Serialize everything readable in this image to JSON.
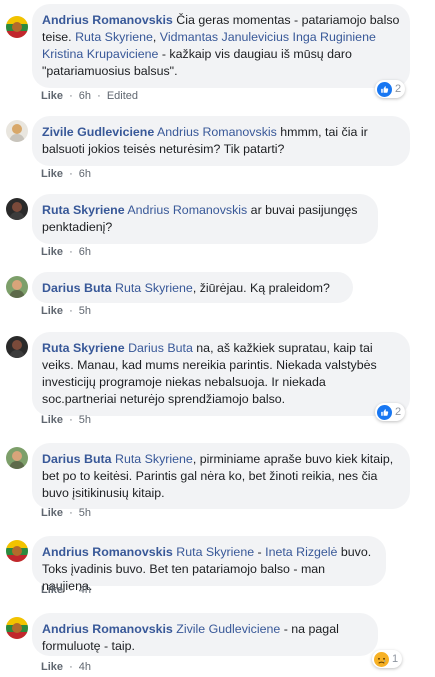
{
  "action_like": "Like",
  "comments": [
    {
      "author": "Andrius Romanovskis",
      "parts": [
        {
          "t": "Čia geras momentas - patariamojo balso teise. "
        },
        {
          "m": "Ruta Skyriene"
        },
        {
          "t": ", "
        },
        {
          "m": "Vidmantas Janulevicius"
        },
        {
          "t": " "
        },
        {
          "m": "Inga Ruginiene"
        },
        {
          "t": " "
        },
        {
          "m": "Kristina Krupaviciene"
        },
        {
          "t": " - kažkaip vis daugiau iš mūsų daro \"patariamuosius balsus\"."
        }
      ],
      "time": "6h",
      "edited": "Edited",
      "reaction": {
        "icon": "like-reaction-icon",
        "count": "2"
      }
    },
    {
      "author": "Zivile Gudleviciene",
      "parts": [
        {
          "m": "Andrius Romanovskis"
        },
        {
          "t": " hmmm, tai čia ir balsuoti jokios teisės neturėsim? Tik patarti?"
        }
      ],
      "time": "6h"
    },
    {
      "author": "Ruta Skyriene",
      "parts": [
        {
          "m": "Andrius Romanovskis"
        },
        {
          "t": " ar buvai pasijungęs penktadienį?"
        }
      ],
      "time": "6h"
    },
    {
      "author": "Darius Buta",
      "parts": [
        {
          "m": "Ruta Skyriene"
        },
        {
          "t": ", žiūrėjau. Ką praleidom?"
        }
      ],
      "time": "5h"
    },
    {
      "author": "Ruta Skyriene",
      "parts": [
        {
          "m": "Darius Buta"
        },
        {
          "t": " na, aš kažkiek supratau, kaip tai veiks. Manau, kad mums nereikia parintis. Niekada valstybės investicijų programoje niekas nebalsuoja. Ir niekada soc.partneriai neturėjo sprendžiamojo balso."
        }
      ],
      "time": "5h",
      "reaction": {
        "icon": "like-reaction-icon",
        "count": "2"
      }
    },
    {
      "author": "Darius Buta",
      "parts": [
        {
          "m": "Ruta Skyriene"
        },
        {
          "t": ", pirminiame apraše buvo kiek kitaip, bet po to keitėsi. Parintis gal nėra ko, bet žinoti reikia, nes čia buvo įsitikinusių kitaip."
        }
      ],
      "time": "5h"
    },
    {
      "author": "Andrius Romanovskis",
      "parts": [
        {
          "m": "Ruta Skyriene"
        },
        {
          "t": " - "
        },
        {
          "m": "Ineta Rizgelė"
        },
        {
          "t": " buvo. Toks įvadinis buvo. Bet ten patariamojo balso - man naujiena."
        }
      ],
      "time": "4h"
    },
    {
      "author": "Andrius Romanovskis",
      "parts": [
        {
          "m": "Zivile Gudleviciene"
        },
        {
          "t": " - na pagal formuluotę - taip."
        }
      ],
      "time": "4h",
      "reaction": {
        "icon": "sad-reaction-icon",
        "count": "1"
      }
    }
  ]
}
